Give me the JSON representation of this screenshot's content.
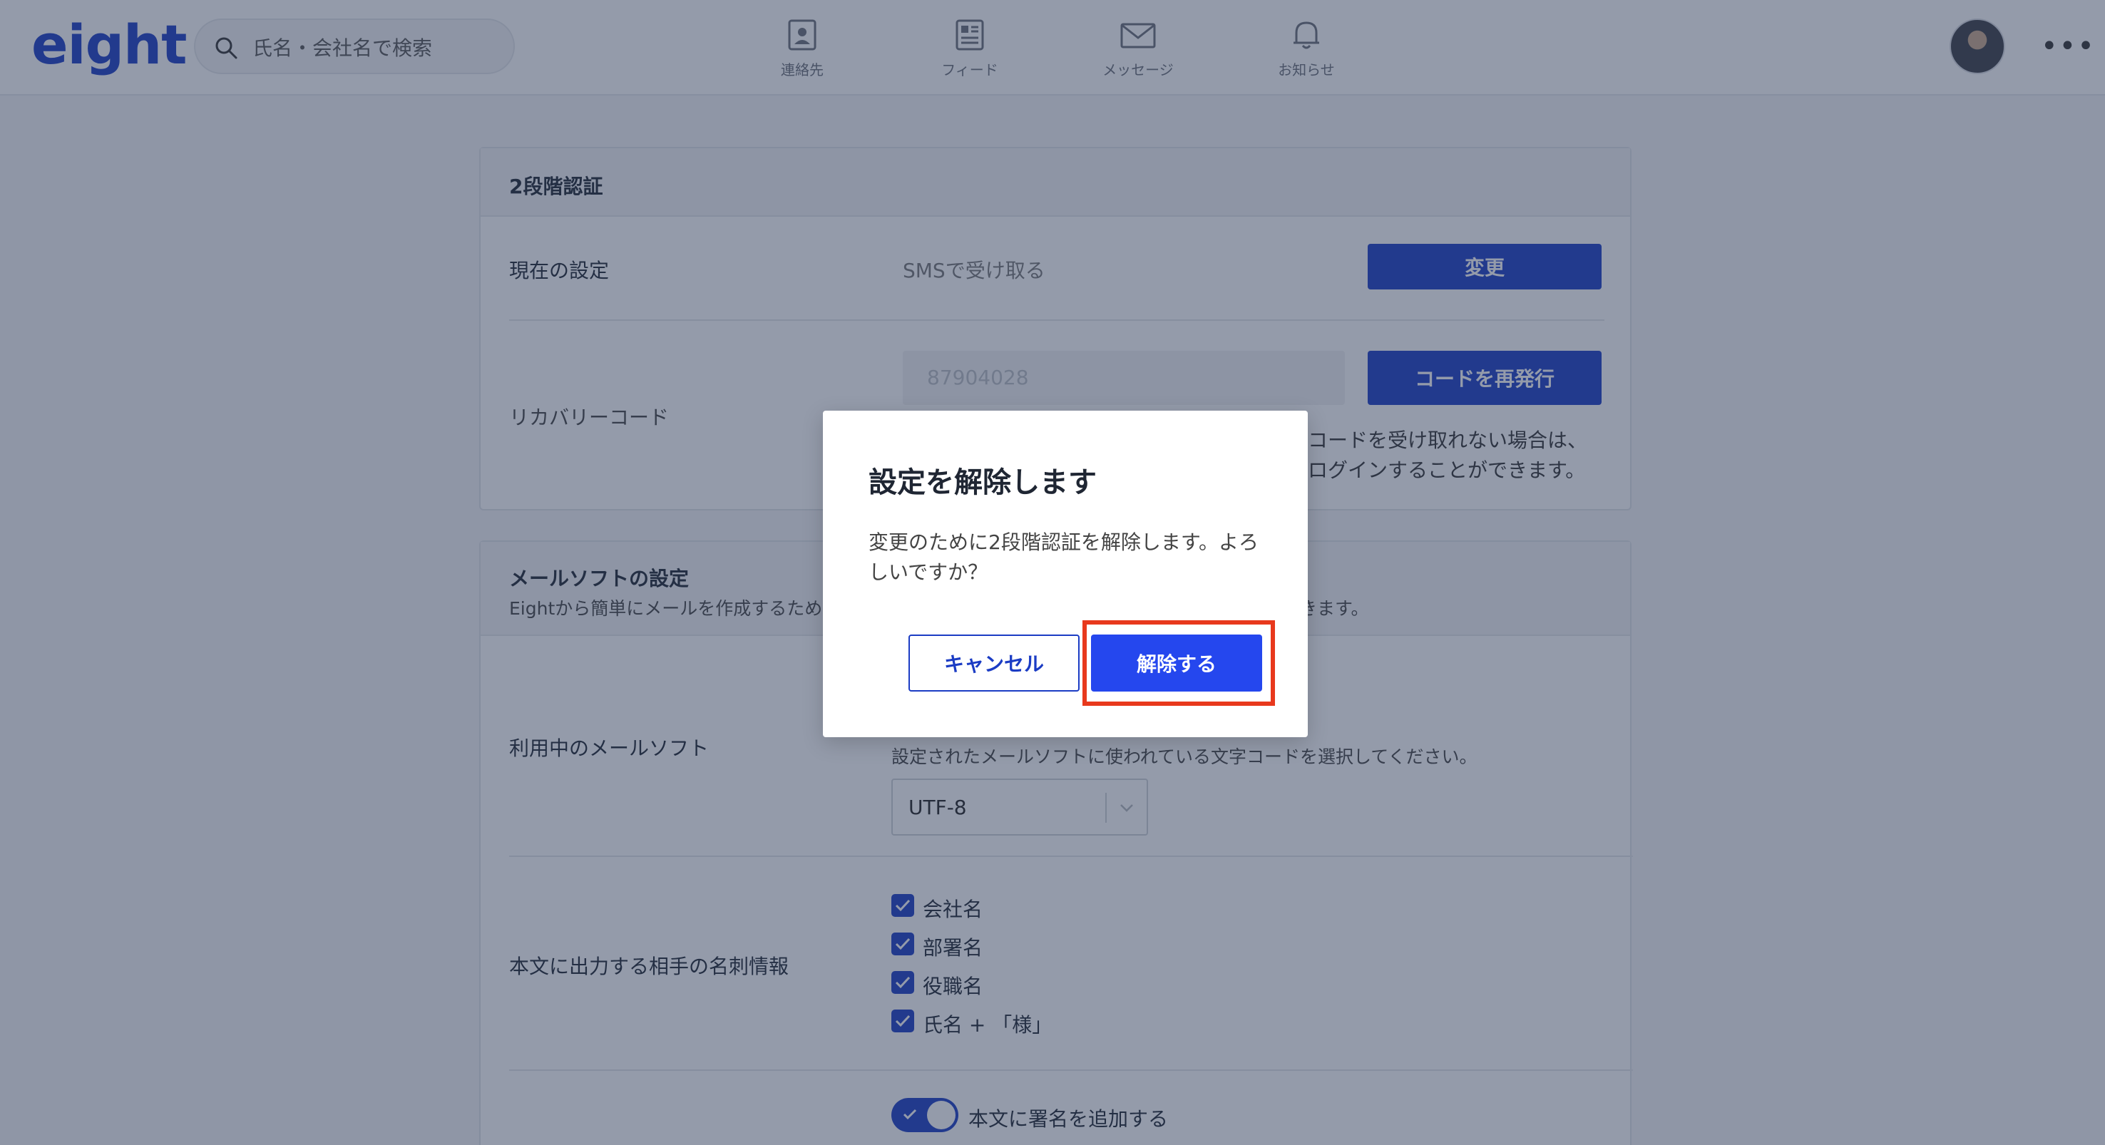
{
  "app": {
    "logo": "eight"
  },
  "search": {
    "placeholder": "氏名・会社名で検索"
  },
  "nav": {
    "contacts": "連絡先",
    "feed": "フィード",
    "messages": "メッセージ",
    "notifications": "お知らせ"
  },
  "two_factor": {
    "title": "2段階認証",
    "current_label": "現在の設定",
    "current_value": "SMSで受け取る",
    "change_button": "変更",
    "recovery_label": "リカバリーコード",
    "recovery_code": "87904028",
    "reissue_button": "コードを再発行",
    "note_line1": "コードを受け取れない場合は、",
    "note_line2": "ログインすることができます。"
  },
  "mail_software": {
    "title": "メールソフトの設定",
    "subtitle_left": "Eightから簡単にメールを作成するために",
    "subtitle_right": "きます。",
    "in_use_label": "利用中のメールソフト",
    "charset_hint": "設定されたメールソフトに使われている文字コードを選択してください。",
    "charset_value": "UTF-8",
    "card_info_label": "本文に出力する相手の名刺情報",
    "checkboxes": [
      "会社名",
      "部署名",
      "役職名",
      "氏名 + 「様」"
    ],
    "signature_toggle_label": "本文に署名を追加する",
    "signature_toggle_on": true
  },
  "modal": {
    "title": "設定を解除します",
    "body": "変更のために2段階認証を解除します。よろしいですか？",
    "cancel": "キャンセル",
    "confirm": "解除する"
  },
  "colors": {
    "brand": "#1b3cc4",
    "confirm": "#2547ee",
    "highlight": "#e8391d"
  }
}
